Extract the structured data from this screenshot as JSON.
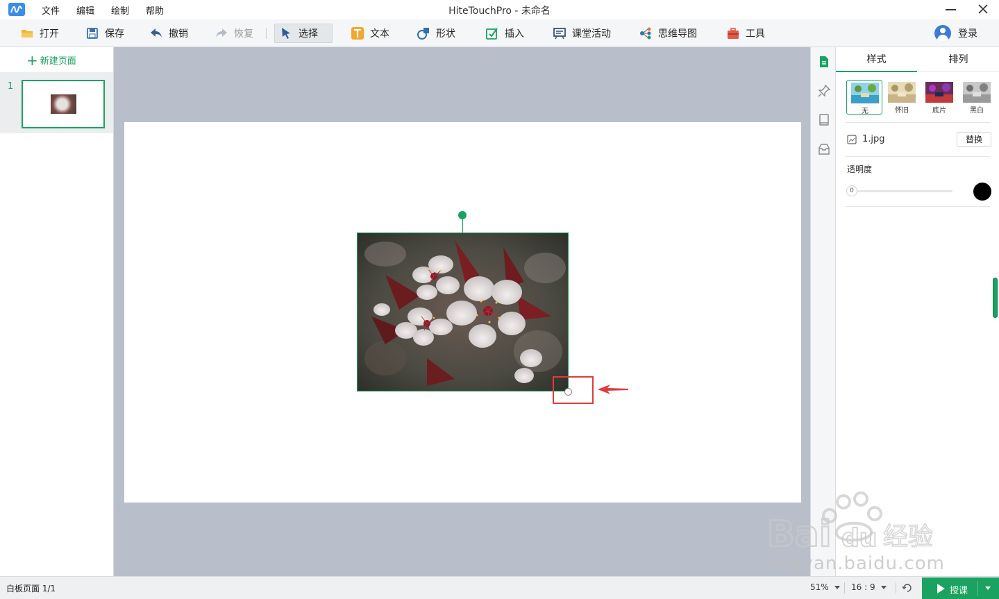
{
  "window": {
    "title": "HiteTouchPro - 未命名"
  },
  "menu": {
    "items": [
      "文件",
      "编辑",
      "绘制",
      "帮助"
    ]
  },
  "toolbar": {
    "open": "打开",
    "save": "保存",
    "undo": "撤销",
    "redo": "恢复",
    "select": "选择",
    "text": "文本",
    "shape": "形状",
    "insert": "插入",
    "activity": "课堂活动",
    "mindmap": "思维导图",
    "tools": "工具",
    "login": "登录"
  },
  "pages": {
    "new_page": "新建页面",
    "items": [
      {
        "number": "1"
      }
    ]
  },
  "properties": {
    "tabs": [
      "样式",
      "排列"
    ],
    "filters": [
      "无",
      "怀旧",
      "底片",
      "黑白"
    ],
    "selected_filter": "无",
    "file_name": "1.jpg",
    "replace": "替换",
    "opacity_label": "透明度",
    "opacity_value": "0",
    "color": "#000000"
  },
  "status": {
    "text": "白板页面 1/1",
    "zoom": "51%",
    "ratio": "16 : 9",
    "teach": "授课"
  },
  "watermark": {
    "text": "jingyan.baidu.com"
  },
  "colors": {
    "accent": "#1aa260",
    "highlight": "#e03a3a",
    "canvas_bg": "#b8bfcb"
  }
}
